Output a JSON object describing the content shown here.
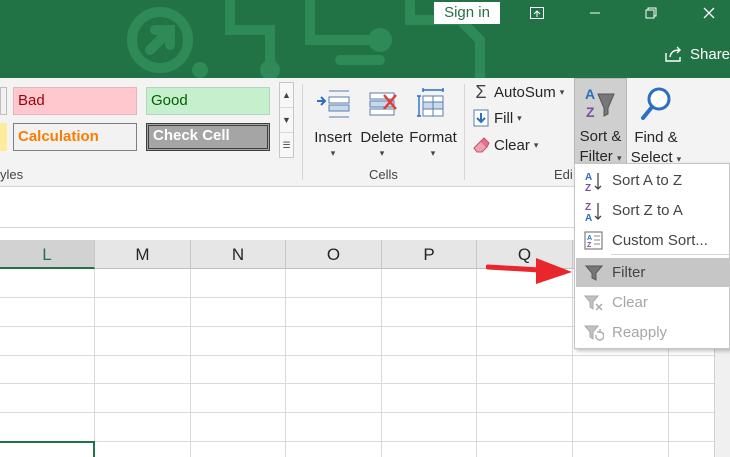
{
  "titlebar": {
    "signin": "Sign in",
    "share": "Share"
  },
  "ribbon": {
    "styles": {
      "bad": "Bad",
      "good": "Good",
      "calculation": "Calculation",
      "check_cell": "Check Cell",
      "group_label": "yles"
    },
    "cells": {
      "insert": "Insert",
      "delete": "Delete",
      "format": "Format",
      "group_label": "Cells"
    },
    "editing": {
      "autosum": "AutoSum",
      "fill": "Fill",
      "clear": "Clear",
      "sort_line1": "Sort &",
      "sort_line2": "Filter",
      "find_line1": "Find &",
      "find_line2": "Select",
      "group_label": "Edi"
    }
  },
  "columns": [
    "L",
    "M",
    "N",
    "O",
    "P",
    "Q"
  ],
  "selected_column": "L",
  "menu": {
    "sort_az": "Sort A to Z",
    "sort_za": "Sort Z to A",
    "custom_sort": "Custom Sort...",
    "filter": "Filter",
    "clear": "Clear",
    "reapply": "Reapply"
  },
  "colors": {
    "excel_green": "#217346",
    "arrow_red": "#e8262c",
    "bad_fill": "#ffc7ce",
    "good_fill": "#c6efce"
  }
}
